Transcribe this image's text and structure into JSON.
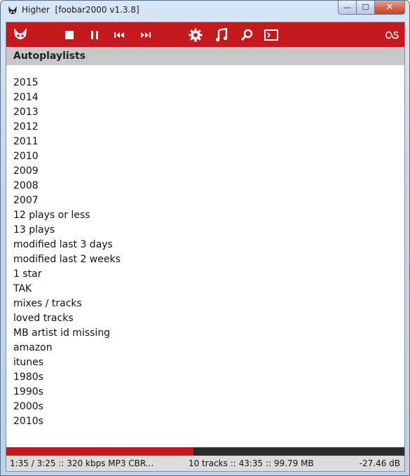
{
  "window": {
    "title": "Higher  [foobar2000 v1.3.8]",
    "controls": {
      "minimize": "—",
      "maximize": "☐",
      "close": "✕"
    }
  },
  "toolbar": {
    "icons": [
      "foobar-logo-icon",
      "stop-icon",
      "pause-icon",
      "previous-icon",
      "next-icon",
      "settings-icon",
      "music-note-icon",
      "search-icon",
      "console-icon",
      "lastfm-icon"
    ]
  },
  "pane": {
    "header": "Autoplaylists",
    "items": [
      "2015",
      "2014",
      "2013",
      "2012",
      "2011",
      "2010",
      "2009",
      "2008",
      "2007",
      "12 plays or less",
      "13 plays",
      "modified last 3 days",
      "modified last 2 weeks",
      "1 star",
      "TAK",
      "mixes / tracks",
      "loved tracks",
      "MB artist id missing",
      "amazon",
      "itunes",
      "1980s",
      "1990s",
      "2000s",
      "2010s"
    ]
  },
  "playback": {
    "progress_fraction": 0.47
  },
  "status": {
    "left": "1:35 / 3:25 :: 320 kbps MP3 CBR...",
    "middle": "10 tracks :: 43:35 :: 99.79 MB",
    "right": "-27.46 dB"
  },
  "colors": {
    "accent": "#c5191e",
    "header_bg": "#c8c8c8",
    "seek_track": "#2c2c2c"
  }
}
